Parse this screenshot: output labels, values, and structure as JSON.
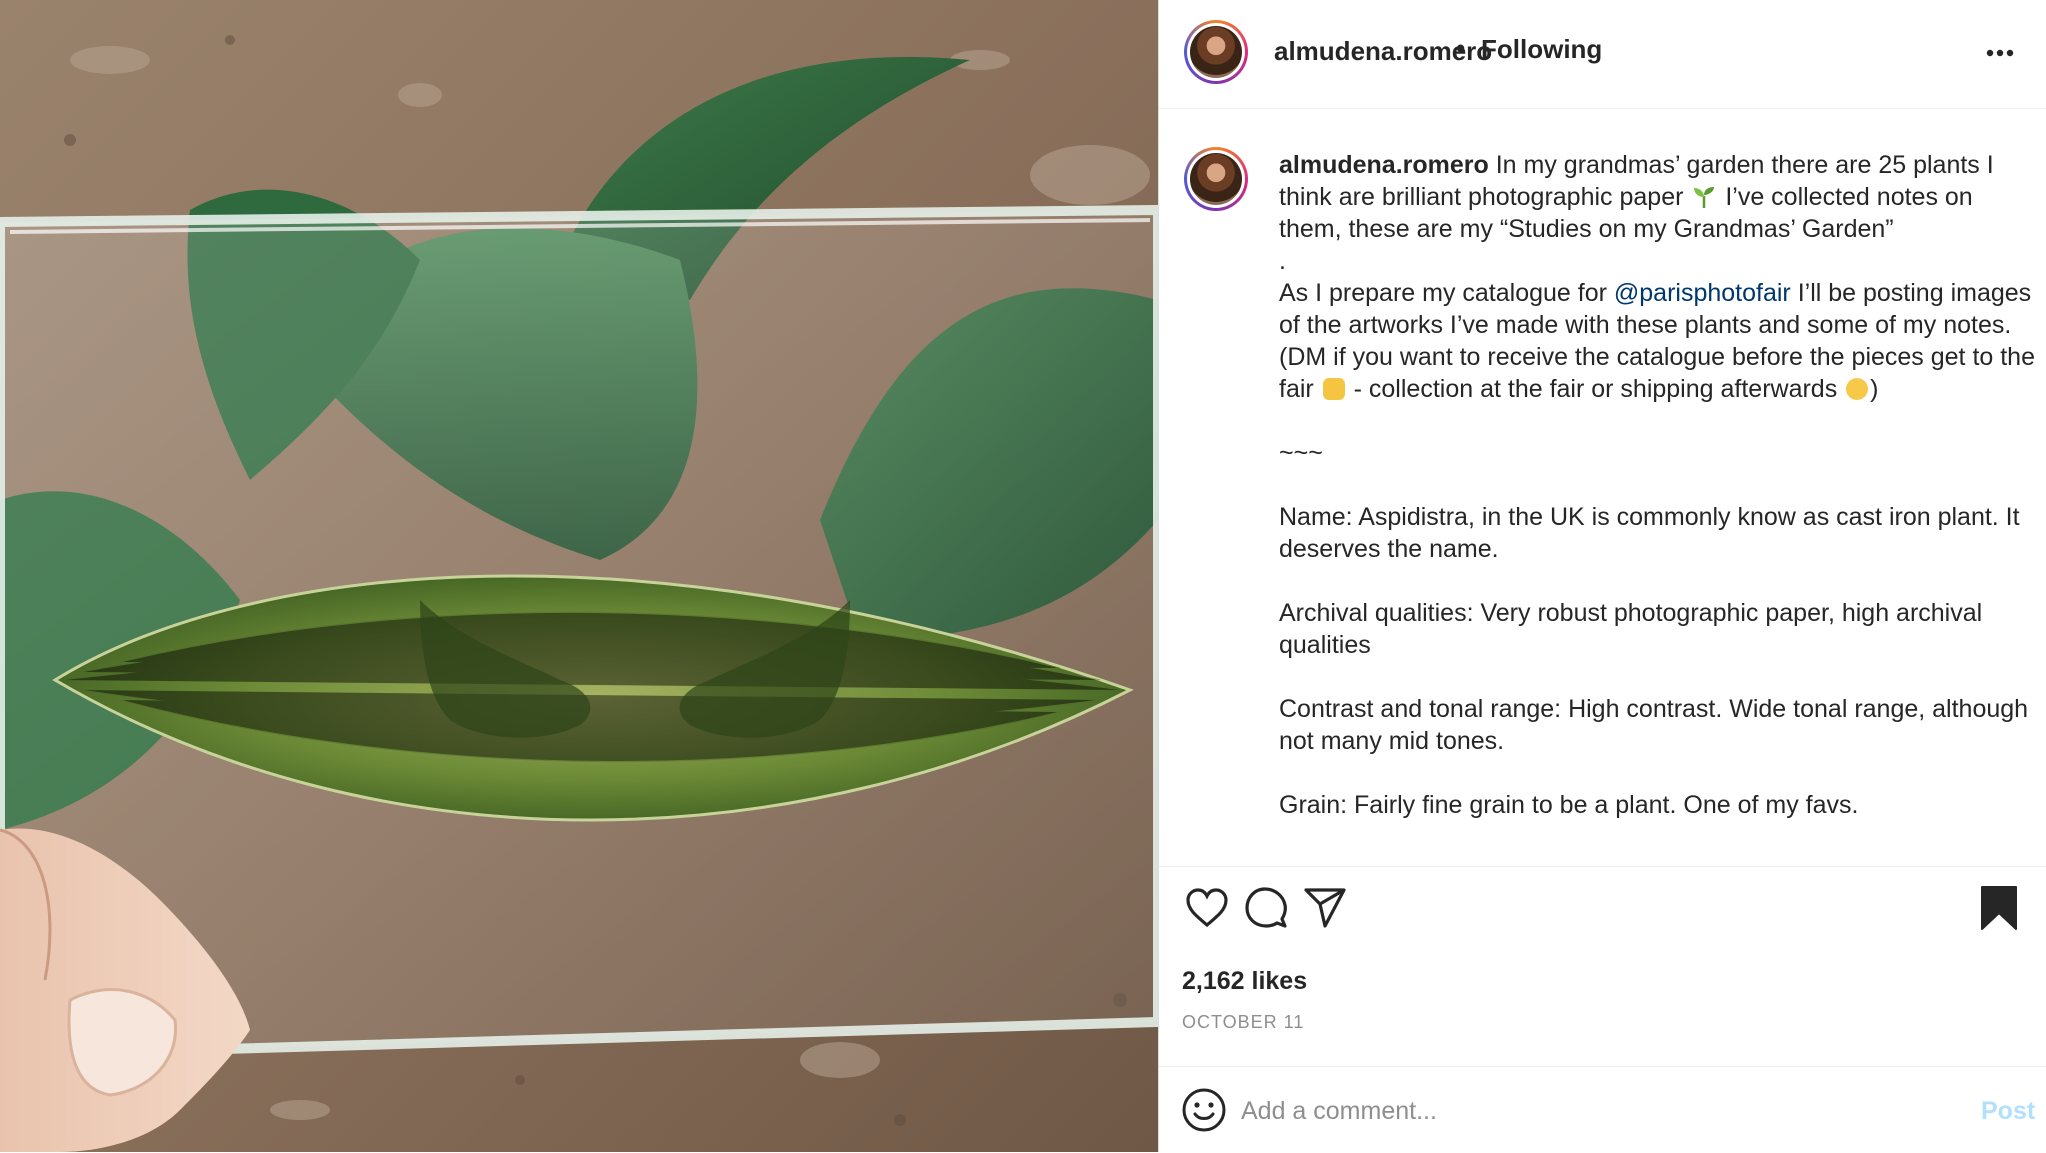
{
  "post": {
    "username": "almudena.romero",
    "separator": "•",
    "follow_status": "Following",
    "photo_alt": "",
    "caption": {
      "username": "almudena.romero",
      "part1": " In my grandmas’ garden there are 25 plants I think are brilliant photographic paper ",
      "part2": " I’ve collected notes on them, these are my “Studies on my Grandmas’ Garden”\n.\nAs I prepare my catalogue for ",
      "mention": "@parisphotofair",
      "part3": " I’ll be posting images of the artworks I’ve made with these plants and some of my notes. (DM if you want to receive the catalogue before the pieces get to the fair ",
      "part4": " - collection at the fair or shipping afterwards ",
      "part5": ")\n\n~~~\n\nName: Aspidistra, in the UK is commonly know as cast iron plant. It deserves the name.\n\nArchival qualities: Very robust photographic paper, high archival qualities\n\nContrast and tonal range: High contrast. Wide tonal range, although not many mid tones.\n\nGrain: Fairly fine grain to be a plant. One of my favs."
    },
    "likes": "2,162 likes",
    "date": "OCTOBER 11",
    "comment_placeholder": "Add a comment...",
    "post_label": "Post",
    "icons": {
      "more": "more-icon",
      "like": "heart-icon",
      "comment": "comment-icon",
      "share": "share-icon",
      "save": "bookmark-icon",
      "emoji": "emoji-icon"
    },
    "colors": {
      "text": "#262626",
      "secondary": "#8e8e8e",
      "mention": "#00376b",
      "post_button_disabled": "#b2dffc",
      "border": "#efefef"
    }
  }
}
